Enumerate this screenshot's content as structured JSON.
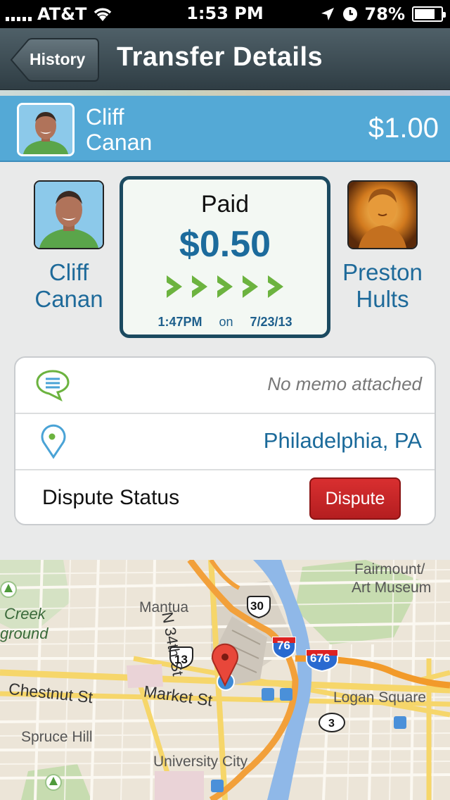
{
  "status_bar": {
    "carrier": "AT&T",
    "time": "1:53 PM",
    "battery": "78%",
    "battery_level": 0.78
  },
  "navbar": {
    "back_label": "History",
    "title": "Transfer Details"
  },
  "sender": {
    "name_line1": "Cliff",
    "name_line2": "Canan",
    "amount": "$1.00"
  },
  "transfer": {
    "from_line1": "Cliff",
    "from_line2": "Canan",
    "to_line1": "Preston",
    "to_line2": "Hults",
    "status": "Paid",
    "amount": "$0.50",
    "time": "1:47PM",
    "on_word": "on",
    "date": "7/23/13"
  },
  "details": {
    "memo": "No memo attached",
    "location": "Philadelphia,  PA",
    "dispute_label": "Dispute Status",
    "dispute_button": "Dispute"
  },
  "map": {
    "labels": {
      "fairmount1": "Fairmount/",
      "fairmount2": "Art Museum",
      "mantua": "Mantua",
      "n34": "N 34th St",
      "creek": "Creek",
      "ground": "ground",
      "chestnut": "Chestnut St",
      "market": "Market St",
      "logan": "Logan Square",
      "spruce": "Spruce Hill",
      "university": "University City"
    },
    "shields": {
      "r30": "30",
      "r76": "76",
      "r676": "676",
      "r13": "13",
      "r3": "3"
    }
  },
  "colors": {
    "accent_blue": "#54a9d6",
    "dark_teal": "#1b4a60",
    "text_blue": "#1c6b9c",
    "dispute_red": "#c82527",
    "chevron_green": "#6cb33f"
  }
}
